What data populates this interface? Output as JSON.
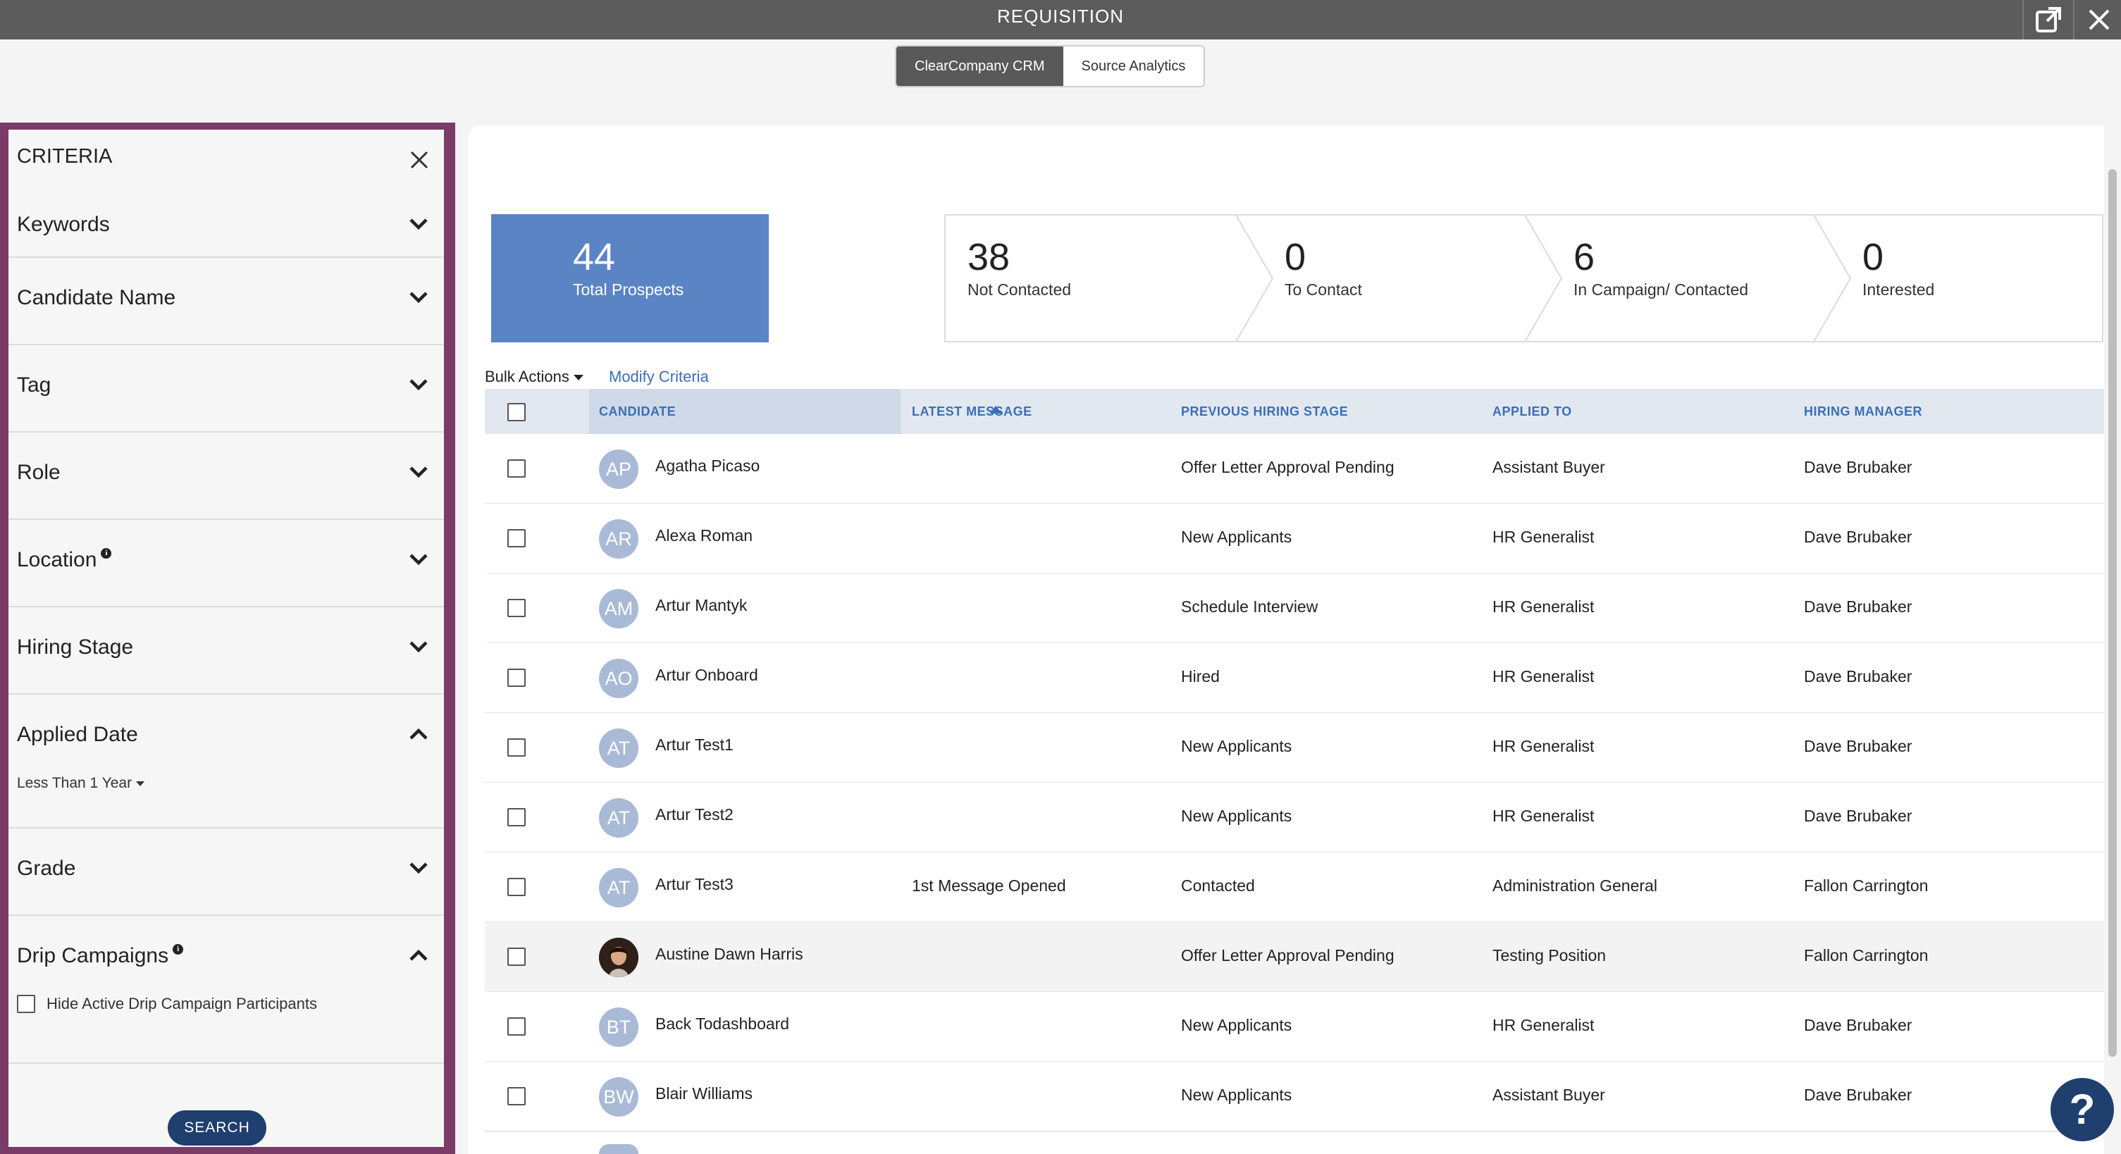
{
  "window": {
    "title": "REQUISITION",
    "popout_icon": "external-link-icon",
    "close_icon": "close-icon"
  },
  "tabs": [
    {
      "label": "ClearCompany CRM",
      "active": true
    },
    {
      "label": "Source Analytics",
      "active": false
    }
  ],
  "criteria": {
    "heading": "CRITERIA",
    "sections": [
      {
        "label": "Keywords",
        "expanded": false
      },
      {
        "label": "Candidate Name",
        "expanded": false
      },
      {
        "label": "Tag",
        "expanded": false
      },
      {
        "label": "Role",
        "expanded": false
      },
      {
        "label": "Location",
        "expanded": false,
        "info": true
      },
      {
        "label": "Hiring Stage",
        "expanded": false
      },
      {
        "label": "Applied Date",
        "expanded": true,
        "value": "Less Than 1 Year"
      },
      {
        "label": "Grade",
        "expanded": false
      },
      {
        "label": "Drip Campaigns",
        "expanded": true,
        "info": true,
        "checkbox_label": "Hide Active Drip Campaign Participants",
        "checked": false
      }
    ],
    "search_label": "SEARCH"
  },
  "stats": {
    "total": {
      "value": "44",
      "label": "Total Prospects"
    },
    "funnel": [
      {
        "value": "38",
        "label": "Not Contacted"
      },
      {
        "value": "0",
        "label": "To Contact"
      },
      {
        "value": "6",
        "label": "In Campaign/ Contacted"
      },
      {
        "value": "0",
        "label": "Interested"
      }
    ]
  },
  "toolbar": {
    "bulk_actions": "Bulk Actions",
    "modify_criteria": "Modify Criteria"
  },
  "table": {
    "columns": [
      "CANDIDATE",
      "LATEST MESSAGE",
      "PREVIOUS HIRING STAGE",
      "APPLIED TO",
      "HIRING MANAGER"
    ],
    "rows": [
      {
        "initials": "AP",
        "name": "Agatha Picaso",
        "message": "",
        "stage": "Offer Letter Approval Pending",
        "applied": "Assistant Buyer",
        "manager": "Dave Brubaker"
      },
      {
        "initials": "AR",
        "name": "Alexa Roman",
        "message": "",
        "stage": "New Applicants",
        "applied": "HR Generalist",
        "manager": "Dave Brubaker"
      },
      {
        "initials": "AM",
        "name": "Artur Mantyk",
        "message": "",
        "stage": "Schedule Interview",
        "applied": "HR Generalist",
        "manager": "Dave Brubaker"
      },
      {
        "initials": "AO",
        "name": "Artur Onboard",
        "message": "",
        "stage": "Hired",
        "applied": "HR Generalist",
        "manager": "Dave Brubaker"
      },
      {
        "initials": "AT",
        "name": "Artur Test1",
        "message": "",
        "stage": "New Applicants",
        "applied": "HR Generalist",
        "manager": "Dave Brubaker"
      },
      {
        "initials": "AT",
        "name": "Artur Test2",
        "message": "",
        "stage": "New Applicants",
        "applied": "HR Generalist",
        "manager": "Dave Brubaker"
      },
      {
        "initials": "AT",
        "name": "Artur Test3",
        "message": "1st Message Opened",
        "stage": "Contacted",
        "applied": "Administration General",
        "manager": "Fallon Carrington"
      },
      {
        "initials": "",
        "name": "Austine Dawn Harris",
        "message": "",
        "stage": "Offer Letter Approval Pending",
        "applied": "Testing Position",
        "manager": "Fallon Carrington",
        "photo": true
      },
      {
        "initials": "BT",
        "name": "Back Todashboard",
        "message": "",
        "stage": "New Applicants",
        "applied": "HR Generalist",
        "manager": "Dave Brubaker"
      },
      {
        "initials": "BW",
        "name": "Blair Williams",
        "message": "",
        "stage": "New Applicants",
        "applied": "Assistant Buyer",
        "manager": "Dave Brubaker"
      }
    ]
  },
  "help": {
    "label": "?",
    "icon": "help-icon"
  },
  "colors": {
    "accent": "#5b84c4",
    "criteria_border": "#7a3b67",
    "link": "#3a6fb7",
    "dark_button": "#1f3f6e"
  }
}
